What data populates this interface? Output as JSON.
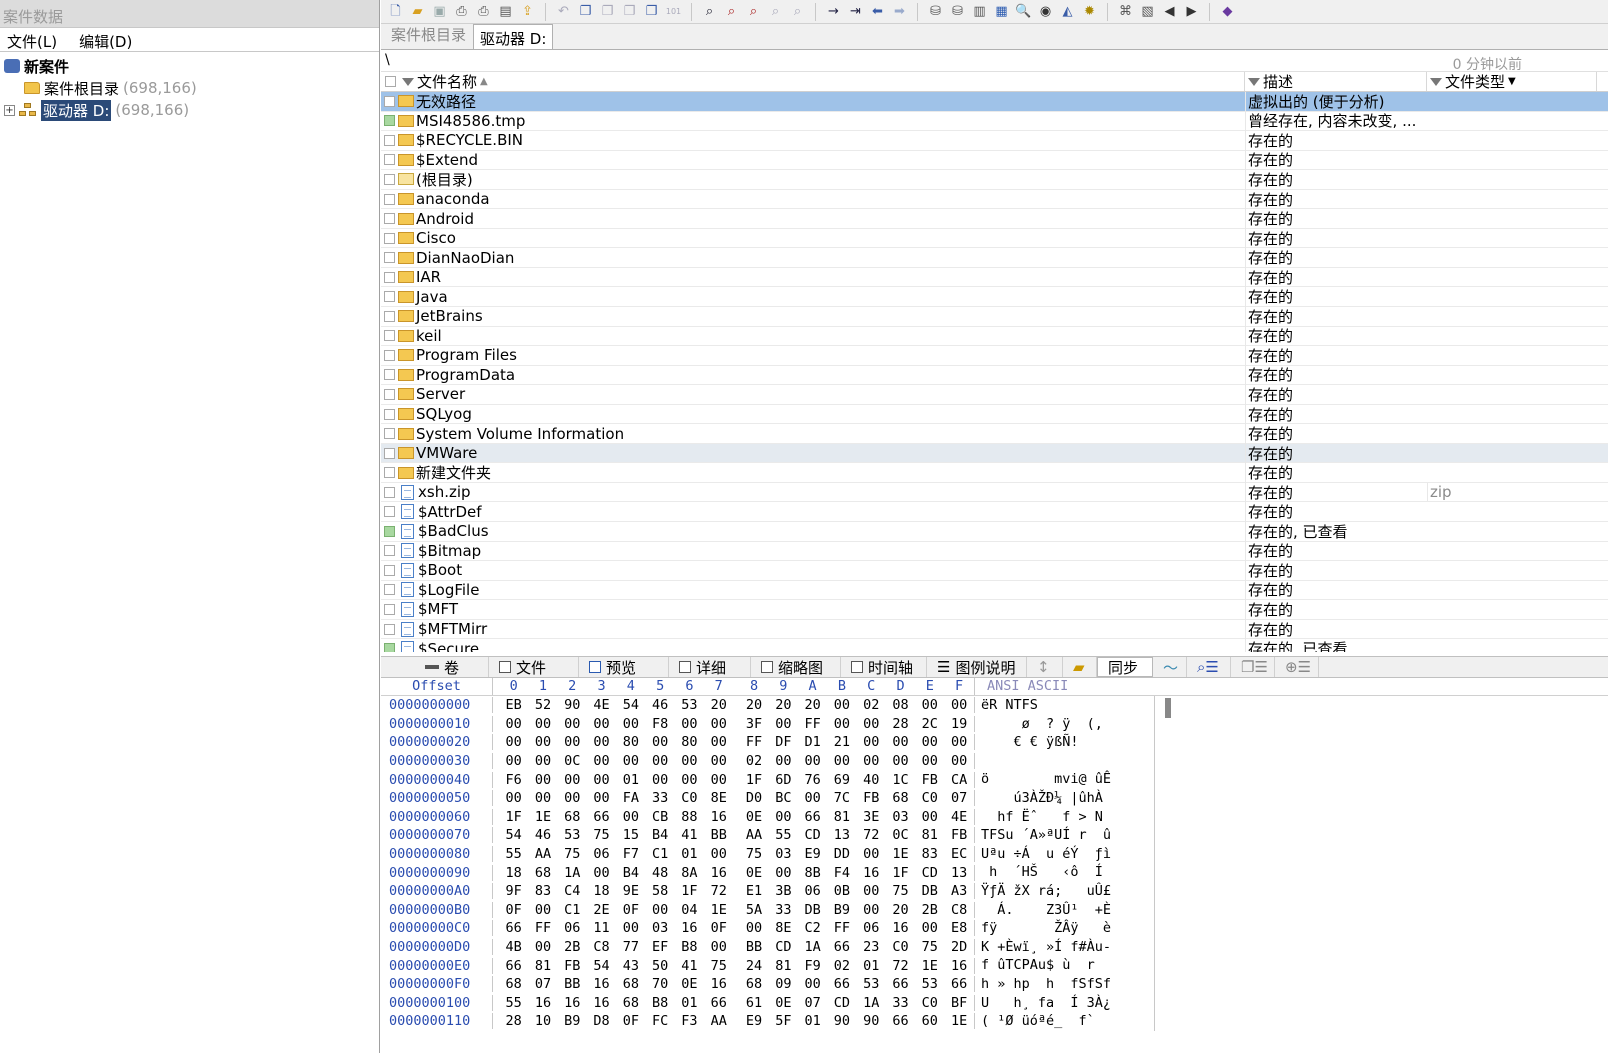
{
  "left": {
    "title": "案件数据",
    "menu": [
      "文件(L)",
      "编辑(D)"
    ],
    "tree": [
      {
        "label": "新案件",
        "count": ""
      },
      {
        "label": "案件根目录",
        "count": "(698,166)"
      },
      {
        "label": "驱动器 D:",
        "count": "(698,166)"
      }
    ]
  },
  "tabs": [
    "案件根目录",
    "驱动器 D:"
  ],
  "path": "\\",
  "timestamp": "0 分钟以前",
  "columns": {
    "name": "文件名称",
    "desc": "描述",
    "type": "文件类型"
  },
  "rows": [
    {
      "name": "无效路径",
      "kind": "folder",
      "desc": "虚拟出的 (便于分析)",
      "type": "",
      "mark": "",
      "state": "sel"
    },
    {
      "name": "MSI48586.tmp",
      "kind": "folder",
      "desc": "曾经存在, 内容未改变, ...",
      "type": "",
      "mark": "green",
      "state": ""
    },
    {
      "name": "$RECYCLE.BIN",
      "kind": "folder",
      "desc": "存在的",
      "type": "",
      "mark": "",
      "state": ""
    },
    {
      "name": "$Extend",
      "kind": "folder",
      "desc": "存在的",
      "type": "",
      "mark": "",
      "state": ""
    },
    {
      "name": "(根目录)",
      "kind": "root",
      "desc": "存在的",
      "type": "",
      "mark": "",
      "state": ""
    },
    {
      "name": "anaconda",
      "kind": "folder",
      "desc": "存在的",
      "type": "",
      "mark": "",
      "state": ""
    },
    {
      "name": "Android",
      "kind": "folder",
      "desc": "存在的",
      "type": "",
      "mark": "",
      "state": ""
    },
    {
      "name": "Cisco",
      "kind": "folder",
      "desc": "存在的",
      "type": "",
      "mark": "",
      "state": ""
    },
    {
      "name": "DianNaoDian",
      "kind": "folder",
      "desc": "存在的",
      "type": "",
      "mark": "",
      "state": ""
    },
    {
      "name": "IAR",
      "kind": "folder",
      "desc": "存在的",
      "type": "",
      "mark": "",
      "state": ""
    },
    {
      "name": "Java",
      "kind": "folder",
      "desc": "存在的",
      "type": "",
      "mark": "",
      "state": ""
    },
    {
      "name": "JetBrains",
      "kind": "folder",
      "desc": "存在的",
      "type": "",
      "mark": "",
      "state": ""
    },
    {
      "name": "keil",
      "kind": "folder",
      "desc": "存在的",
      "type": "",
      "mark": "",
      "state": ""
    },
    {
      "name": "Program Files",
      "kind": "folder",
      "desc": "存在的",
      "type": "",
      "mark": "",
      "state": ""
    },
    {
      "name": "ProgramData",
      "kind": "folder",
      "desc": "存在的",
      "type": "",
      "mark": "",
      "state": ""
    },
    {
      "name": "Server",
      "kind": "folder",
      "desc": "存在的",
      "type": "",
      "mark": "",
      "state": ""
    },
    {
      "name": "SQLyog",
      "kind": "folder",
      "desc": "存在的",
      "type": "",
      "mark": "",
      "state": ""
    },
    {
      "name": "System Volume Information",
      "kind": "folder",
      "desc": "存在的",
      "type": "",
      "mark": "",
      "state": ""
    },
    {
      "name": "VMWare",
      "kind": "folder",
      "desc": "存在的",
      "type": "",
      "mark": "",
      "state": "hl"
    },
    {
      "name": "新建文件夹",
      "kind": "folder",
      "desc": "存在的",
      "type": "",
      "mark": "",
      "state": ""
    },
    {
      "name": "xsh.zip",
      "kind": "file",
      "desc": "存在的",
      "type": "zip",
      "mark": "",
      "state": ""
    },
    {
      "name": "$AttrDef",
      "kind": "file",
      "desc": "存在的",
      "type": "",
      "mark": "",
      "state": ""
    },
    {
      "name": "$BadClus",
      "kind": "file",
      "desc": "存在的, 已查看",
      "type": "",
      "mark": "green",
      "state": ""
    },
    {
      "name": "$Bitmap",
      "kind": "file",
      "desc": "存在的",
      "type": "",
      "mark": "",
      "state": ""
    },
    {
      "name": "$Boot",
      "kind": "file",
      "desc": "存在的",
      "type": "",
      "mark": "",
      "state": ""
    },
    {
      "name": "$LogFile",
      "kind": "file",
      "desc": "存在的",
      "type": "",
      "mark": "",
      "state": ""
    },
    {
      "name": "$MFT",
      "kind": "file",
      "desc": "存在的",
      "type": "",
      "mark": "",
      "state": ""
    },
    {
      "name": "$MFTMirr",
      "kind": "file",
      "desc": "存在的",
      "type": "",
      "mark": "",
      "state": ""
    },
    {
      "name": "$Secure",
      "kind": "file",
      "desc": "存在的, 已查看",
      "type": "",
      "mark": "green",
      "state": ""
    }
  ],
  "lower_tabs": [
    "卷",
    "文件",
    "预览",
    "详细",
    "缩略图",
    "时间轴",
    "图例说明",
    "同步"
  ],
  "hex": {
    "offset_label": "Offset",
    "col_labels": [
      "0",
      "1",
      "2",
      "3",
      "4",
      "5",
      "6",
      "7",
      "8",
      "9",
      "A",
      "B",
      "C",
      "D",
      "E",
      "F"
    ],
    "text_label": "ANSI ASCII",
    "rows": [
      {
        "off": "0000000000",
        "bytes": "EB 52 90 4E 54 46 53 20 20 20 20 00 02 08 00 00",
        "text": "ëR NTFS"
      },
      {
        "off": "0000000010",
        "bytes": "00 00 00 00 00 F8 00 00 3F 00 FF 00 00 28 2C 19",
        "text": "     ø  ? ÿ  (,"
      },
      {
        "off": "0000000020",
        "bytes": "00 00 00 00 80 00 80 00 FF DF D1 21 00 00 00 00",
        "text": "    € € ÿßÑ!"
      },
      {
        "off": "0000000030",
        "bytes": "00 00 0C 00 00 00 00 00 02 00 00 00 00 00 00 00",
        "text": ""
      },
      {
        "off": "0000000040",
        "bytes": "F6 00 00 00 01 00 00 00 1F 6D 76 69 40 1C FB CA",
        "text": "ö        mvi@ ûÊ"
      },
      {
        "off": "0000000050",
        "bytes": "00 00 00 00 FA 33 C0 8E D0 BC 00 7C FB 68 C0 07",
        "text": "    ú3ÀŽÐ¼ |ûhÀ"
      },
      {
        "off": "0000000060",
        "bytes": "1F 1E 68 66 00 CB 88 16 0E 00 66 81 3E 03 00 4E",
        "text": "  hf Ëˆ   f > N"
      },
      {
        "off": "0000000070",
        "bytes": "54 46 53 75 15 B4 41 BB AA 55 CD 13 72 0C 81 FB",
        "text": "TFSu ´A»ªUÍ r  û"
      },
      {
        "off": "0000000080",
        "bytes": "55 AA 75 06 F7 C1 01 00 75 03 E9 DD 00 1E 83 EC",
        "text": "Uªu ÷Á  u éÝ  ƒì"
      },
      {
        "off": "0000000090",
        "bytes": "18 68 1A 00 B4 48 8A 16 0E 00 8B F4 16 1F CD 13",
        "text": " h  ´HŠ   ‹ô  Í"
      },
      {
        "off": "00000000A0",
        "bytes": "9F 83 C4 18 9E 58 1F 72 E1 3B 06 0B 00 75 DB A3",
        "text": "ŸƒÄ žX rá;   uÛ£"
      },
      {
        "off": "00000000B0",
        "bytes": "0F 00 C1 2E 0F 00 04 1E 5A 33 DB B9 00 20 2B C8",
        "text": "  Á.    Z3Û¹  +È"
      },
      {
        "off": "00000000C0",
        "bytes": "66 FF 06 11 00 03 16 0F 00 8E C2 FF 06 16 00 E8",
        "text": "fÿ       ŽÂÿ   è"
      },
      {
        "off": "00000000D0",
        "bytes": "4B 00 2B C8 77 EF B8 00 BB CD 1A 66 23 C0 75 2D",
        "text": "K +Èwï¸ »Í f#Àu-"
      },
      {
        "off": "00000000E0",
        "bytes": "66 81 FB 54 43 50 41 75 24 81 F9 02 01 72 1E 16",
        "text": "f ûTCPAu$ ù  r"
      },
      {
        "off": "00000000F0",
        "bytes": "68 07 BB 16 68 70 0E 16 68 09 00 66 53 66 53 66",
        "text": "h » hp  h  fSfSf"
      },
      {
        "off": "0000000100",
        "bytes": "55 16 16 16 68 B8 01 66 61 0E 07 CD 1A 33 C0 BF",
        "text": "U   h¸ fa  Í 3À¿"
      },
      {
        "off": "0000000110",
        "bytes": "28 10 B9 D8 0F FC F3 AA E9 5F 01 90 90 66 60 1E",
        "text": "( ¹Ø üóªé_  f`"
      }
    ]
  }
}
